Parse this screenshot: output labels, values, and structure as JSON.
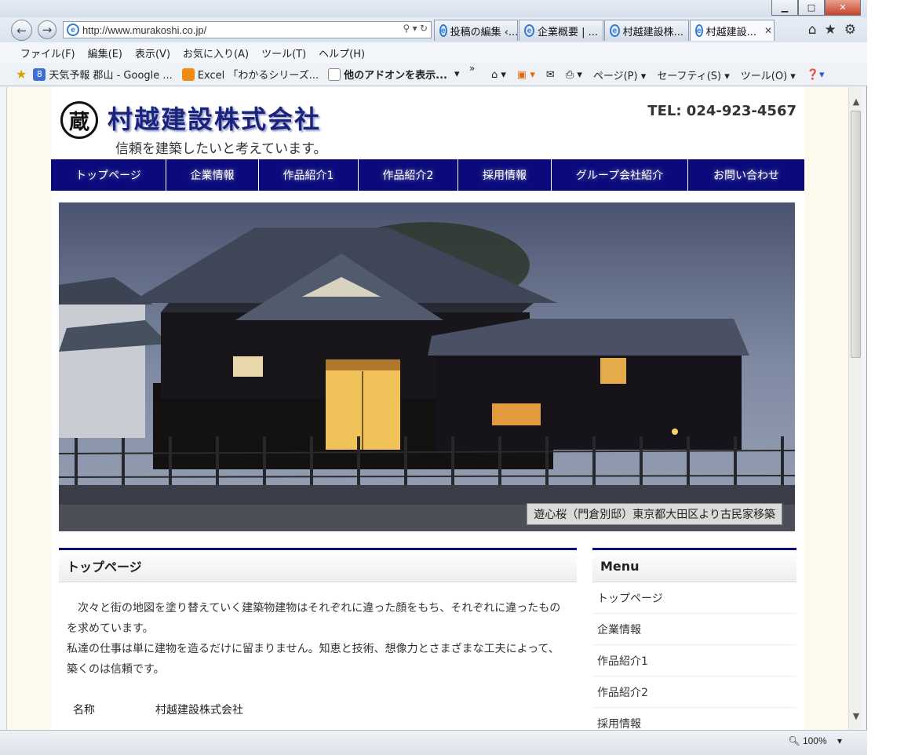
{
  "browser": {
    "address": "http://www.murakoshi.co.jp/",
    "tabs": [
      {
        "label": "投稿の編集 ‹..."
      },
      {
        "label": "企業概要 | ..."
      },
      {
        "label": "村越建設株..."
      },
      {
        "label": "村越建設...",
        "close": "✕"
      }
    ],
    "menu": [
      "ファイル(F)",
      "編集(E)",
      "表示(V)",
      "お気に入り(A)",
      "ツール(T)",
      "ヘルプ(H)"
    ],
    "favorites": [
      {
        "label": "天気予報 郡山 - Google ..."
      },
      {
        "label": "Excel 「わかるシリーズ..."
      },
      {
        "label": "他のアドオンを表示..."
      }
    ],
    "commands": {
      "page": "ページ(P)",
      "safety": "セーフティ(S)",
      "tools": "ツール(O)"
    },
    "zoom": "100%"
  },
  "site": {
    "logo_char": "蔵",
    "name": "村越建設株式会社",
    "tagline": "信頼を建築したいと考えています。",
    "tel": "TEL: 024-923-4567",
    "nav": [
      "トップページ",
      "企業情報",
      "作品紹介1",
      "作品紹介2",
      "採用情報",
      "グループ会社紹介",
      "お問い合わせ"
    ],
    "hero_caption": "遊心桜（門倉別邸）東京都大田区より古民家移築"
  },
  "main": {
    "heading": "トップページ",
    "para1": "　次々と街の地図を塗り替えていく建築物建物はそれぞれに違った顔をもち、それぞれに違ったものを求めています。",
    "para2": "私達の仕事は単に建物を造るだけに留まりません。知恵と技術、想像力とさまざまな工夫によって、築くのは信頼です。",
    "info_key": "名称",
    "info_value": "村越建設株式会社"
  },
  "sidebar": {
    "heading": "Menu",
    "items": [
      "トップページ",
      "企業情報",
      "作品紹介1",
      "作品紹介2",
      "採用情報"
    ]
  },
  "colors": {
    "nav_bg": "#0a0a7c",
    "brand_text": "#1a237e"
  }
}
